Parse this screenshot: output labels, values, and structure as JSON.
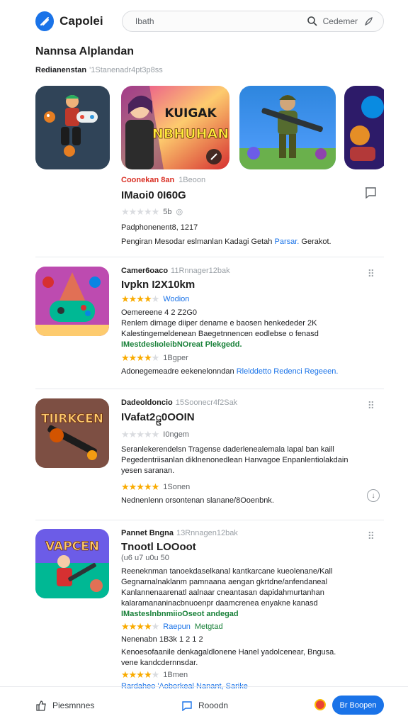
{
  "header": {
    "title": "Capolei",
    "search_placeholder": "Ibath",
    "account_label": "Cedemer"
  },
  "section": {
    "title": "Nannsa Alplandan",
    "subtitle_bold": "Redianenstan",
    "subtitle_gray": "'1Stanenadr4pt3p8ss"
  },
  "carousel": {
    "banner_title_top": "KUIGAK",
    "banner_title_bottom": "NBHUHAN"
  },
  "featured": {
    "category": "Coonekan 8an",
    "tag": "1Beoon",
    "name": "IMaoi0 0I60G",
    "rating_stars": 0,
    "rating_label": "5b",
    "publisher": "Padphonenent8, 1217",
    "description": "Pengiran Mesodar eslmanlan Kadagi Getah",
    "link1": "Parsar.",
    "link2": "Gerakot."
  },
  "apps": [
    {
      "category": "Camer6oaco",
      "tag": "11Rnnager12bak",
      "name": "Ivpkn I2X10km",
      "rating_stars": 4,
      "rating_label": "Wodion",
      "line1": "Oemereene 4 2 Z2G0",
      "line2": "Renlem dirnage diiper dename e baosen henkededer 2K",
      "line3": "Kalestingemeldenean Baegetnnencen eodlebse o fenasd",
      "green": "IMestdeslıoleibNOreat Plekgedd.",
      "rating2_stars": 4,
      "rating2_label": "1Bgper",
      "desc": "Adonegemeadre eekenelonndan",
      "desc_link": "Rlelddetto Redenci Regeeen."
    },
    {
      "category": "Dadeoldoncio",
      "tag": "15Soonecr4f2Sak",
      "name": "IVafat2ဠ0OOIN",
      "rating_stars": 0,
      "rating_label": "I0ngem",
      "line1": "Seranlekerendelsn Tragense daderlenealemala lapal ban kaill",
      "line2": "Pegedentriisanlan diklnenonedlean Hanvagoe Enpanlentiolakdain",
      "line3": "yesen saranan.",
      "rating2_stars": 5,
      "rating2_label": "1Sonen",
      "desc": "Nednenlenn orsontenan slanane/8Ooenbnk."
    },
    {
      "category": "Pannet Bngna",
      "tag": "13Rnnagen12bak",
      "name": "Tnootl LOOoot",
      "sub": "(u6 u7 u0u 50",
      "line1": "Reeneknman tanoekdaselkanal kantkarcane kueolenane/Kall",
      "line2": "Gegnarnalnaklanm pamnaana aengan gkrtdne/anfendaneal",
      "line3": "Kanlannenaarenatl aalnaar cneantasan dapidahmurtanhan",
      "line4": "kalaramananinacbnuoenpr daamcrenea enyakne kanasd",
      "green": "IMasteslnbnmiioOseot andegad",
      "rating_stars": 4,
      "rating_label": "Raepun",
      "rating_label2": "Metgtad",
      "line5": "Nenenabn 1B3k 1 2 1 2",
      "line6": "Kenoesofaanile denkagaldlonene Hanel yadolcenear, Bngusa.",
      "line7": "vene kandcdernnsdar.",
      "rating2_stars": 4,
      "rating2_label": "1Bmen",
      "desc_link": "Rardaheo 'Aoborkeal Nanant, Sarike"
    }
  ],
  "bottom_bar": {
    "home_label": "Piesmnnes",
    "rooms_label": "Rooodn",
    "cta_label": "Br Boopen"
  }
}
